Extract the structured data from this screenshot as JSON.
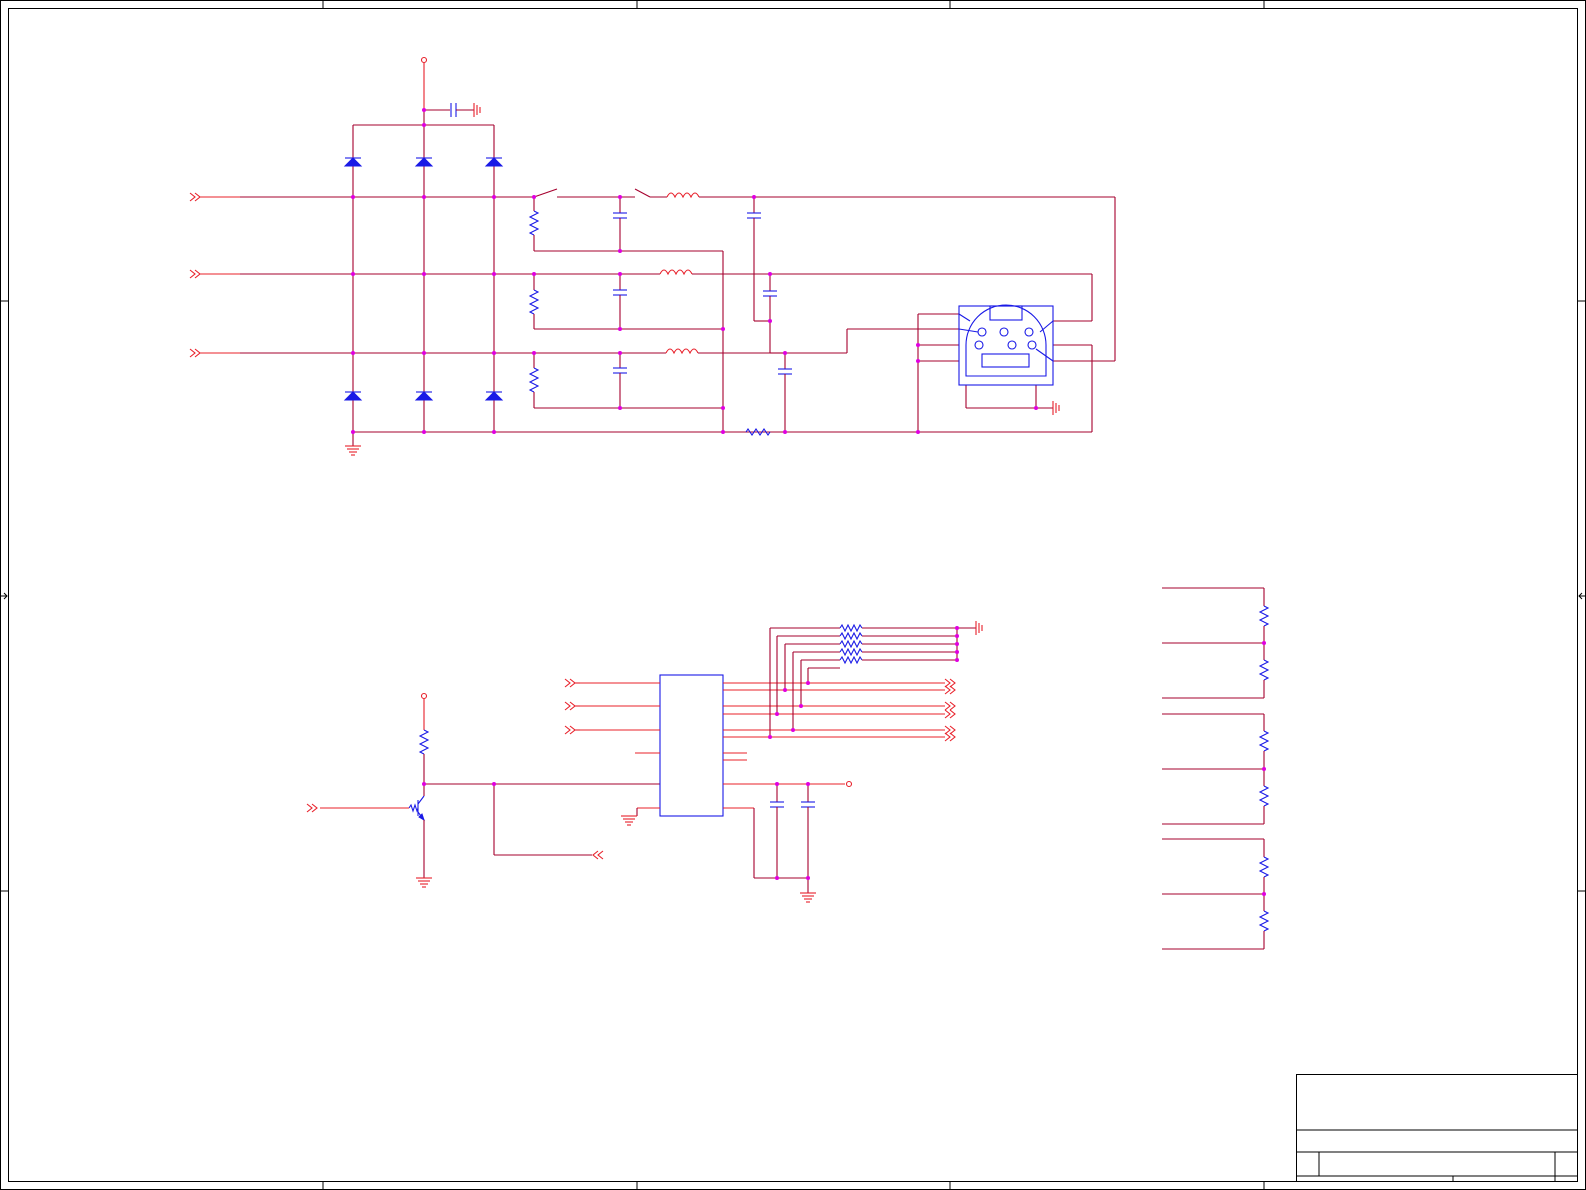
{
  "schematic": {
    "sheet_size": "1586x1190",
    "colors": {
      "wire": "#a5002e",
      "net_port": "#e8202a",
      "component": "#1a1ae6",
      "junction": "#e000e0",
      "frame": "#000000"
    },
    "icons": [
      "diode-icon",
      "resistor-icon",
      "capacitor-icon",
      "inductor-icon",
      "ground-icon",
      "chassis-ground-icon",
      "net-port-icon",
      "power-pin-icon",
      "npn-transistor-icon",
      "mini-din-connector-icon",
      "ic-package-icon"
    ],
    "title_block": {}
  }
}
